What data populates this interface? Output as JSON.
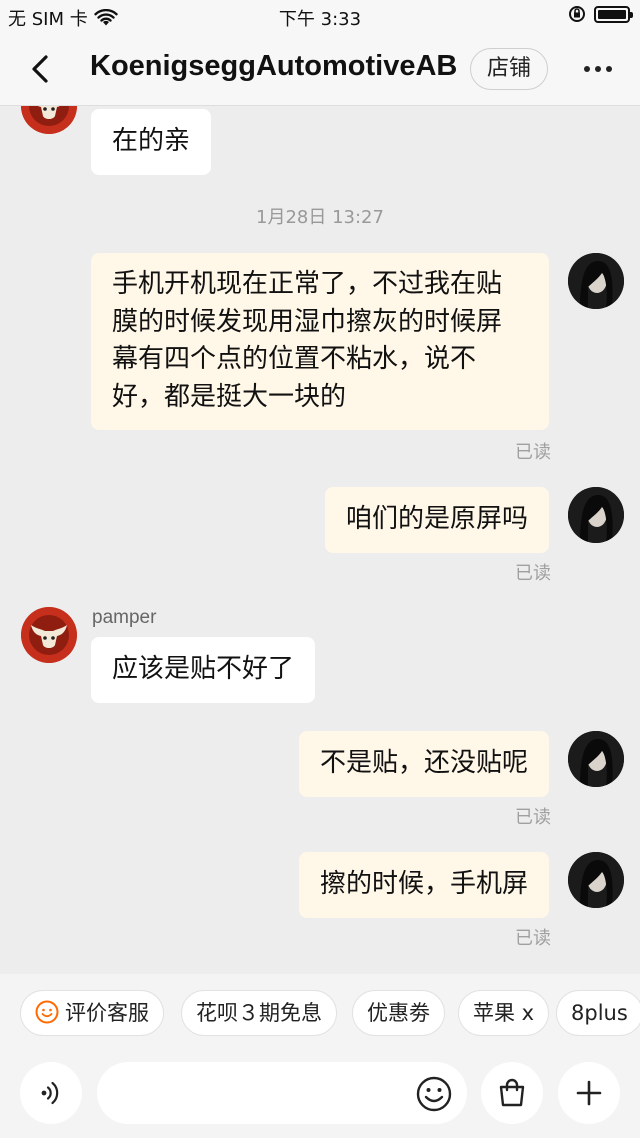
{
  "status_bar": {
    "carrier": "无 SIM 卡",
    "time": "下午 3:33"
  },
  "nav": {
    "title": "KoenigseggAutomotiveAB",
    "shop_label": "店铺"
  },
  "messages": [
    {
      "side": "left",
      "text": "在的亲"
    },
    {
      "type": "timestamp",
      "text": "1月28日 13:27"
    },
    {
      "side": "right",
      "lines": [
        "手机开机现在正常了，不过我在贴",
        "膜的时候发现用湿巾擦灰的时候屏",
        "幕有四个点的位置不粘水，说不",
        "好，都是挺大一块的"
      ],
      "status": "已读"
    },
    {
      "side": "right",
      "text": "咱们的是原屏吗",
      "status": "已读"
    },
    {
      "side": "left",
      "sender": "pamper",
      "text": "应该是贴不好了"
    },
    {
      "side": "right",
      "text": "不是贴，还没贴呢",
      "status": "已读"
    },
    {
      "side": "right",
      "text": "擦的时候，手机屏",
      "status": "已读"
    }
  ],
  "quick_replies": [
    "评价客服",
    "花呗３期免息",
    "优惠劵",
    "苹果 x",
    "8plus"
  ],
  "input": {
    "placeholder": ""
  },
  "colors": {
    "background": "#ededed",
    "bubble_self": "#fff7e8",
    "bubble_other": "#ffffff",
    "accent_orange": "#ff6a00"
  },
  "icons": {
    "back": "chevron-left-icon",
    "more": "more-dots-icon",
    "voice": "voice-icon",
    "emoji": "smiley-icon",
    "bag": "shopping-bag-icon",
    "plus": "plus-icon",
    "rate": "smile-circle-icon"
  }
}
